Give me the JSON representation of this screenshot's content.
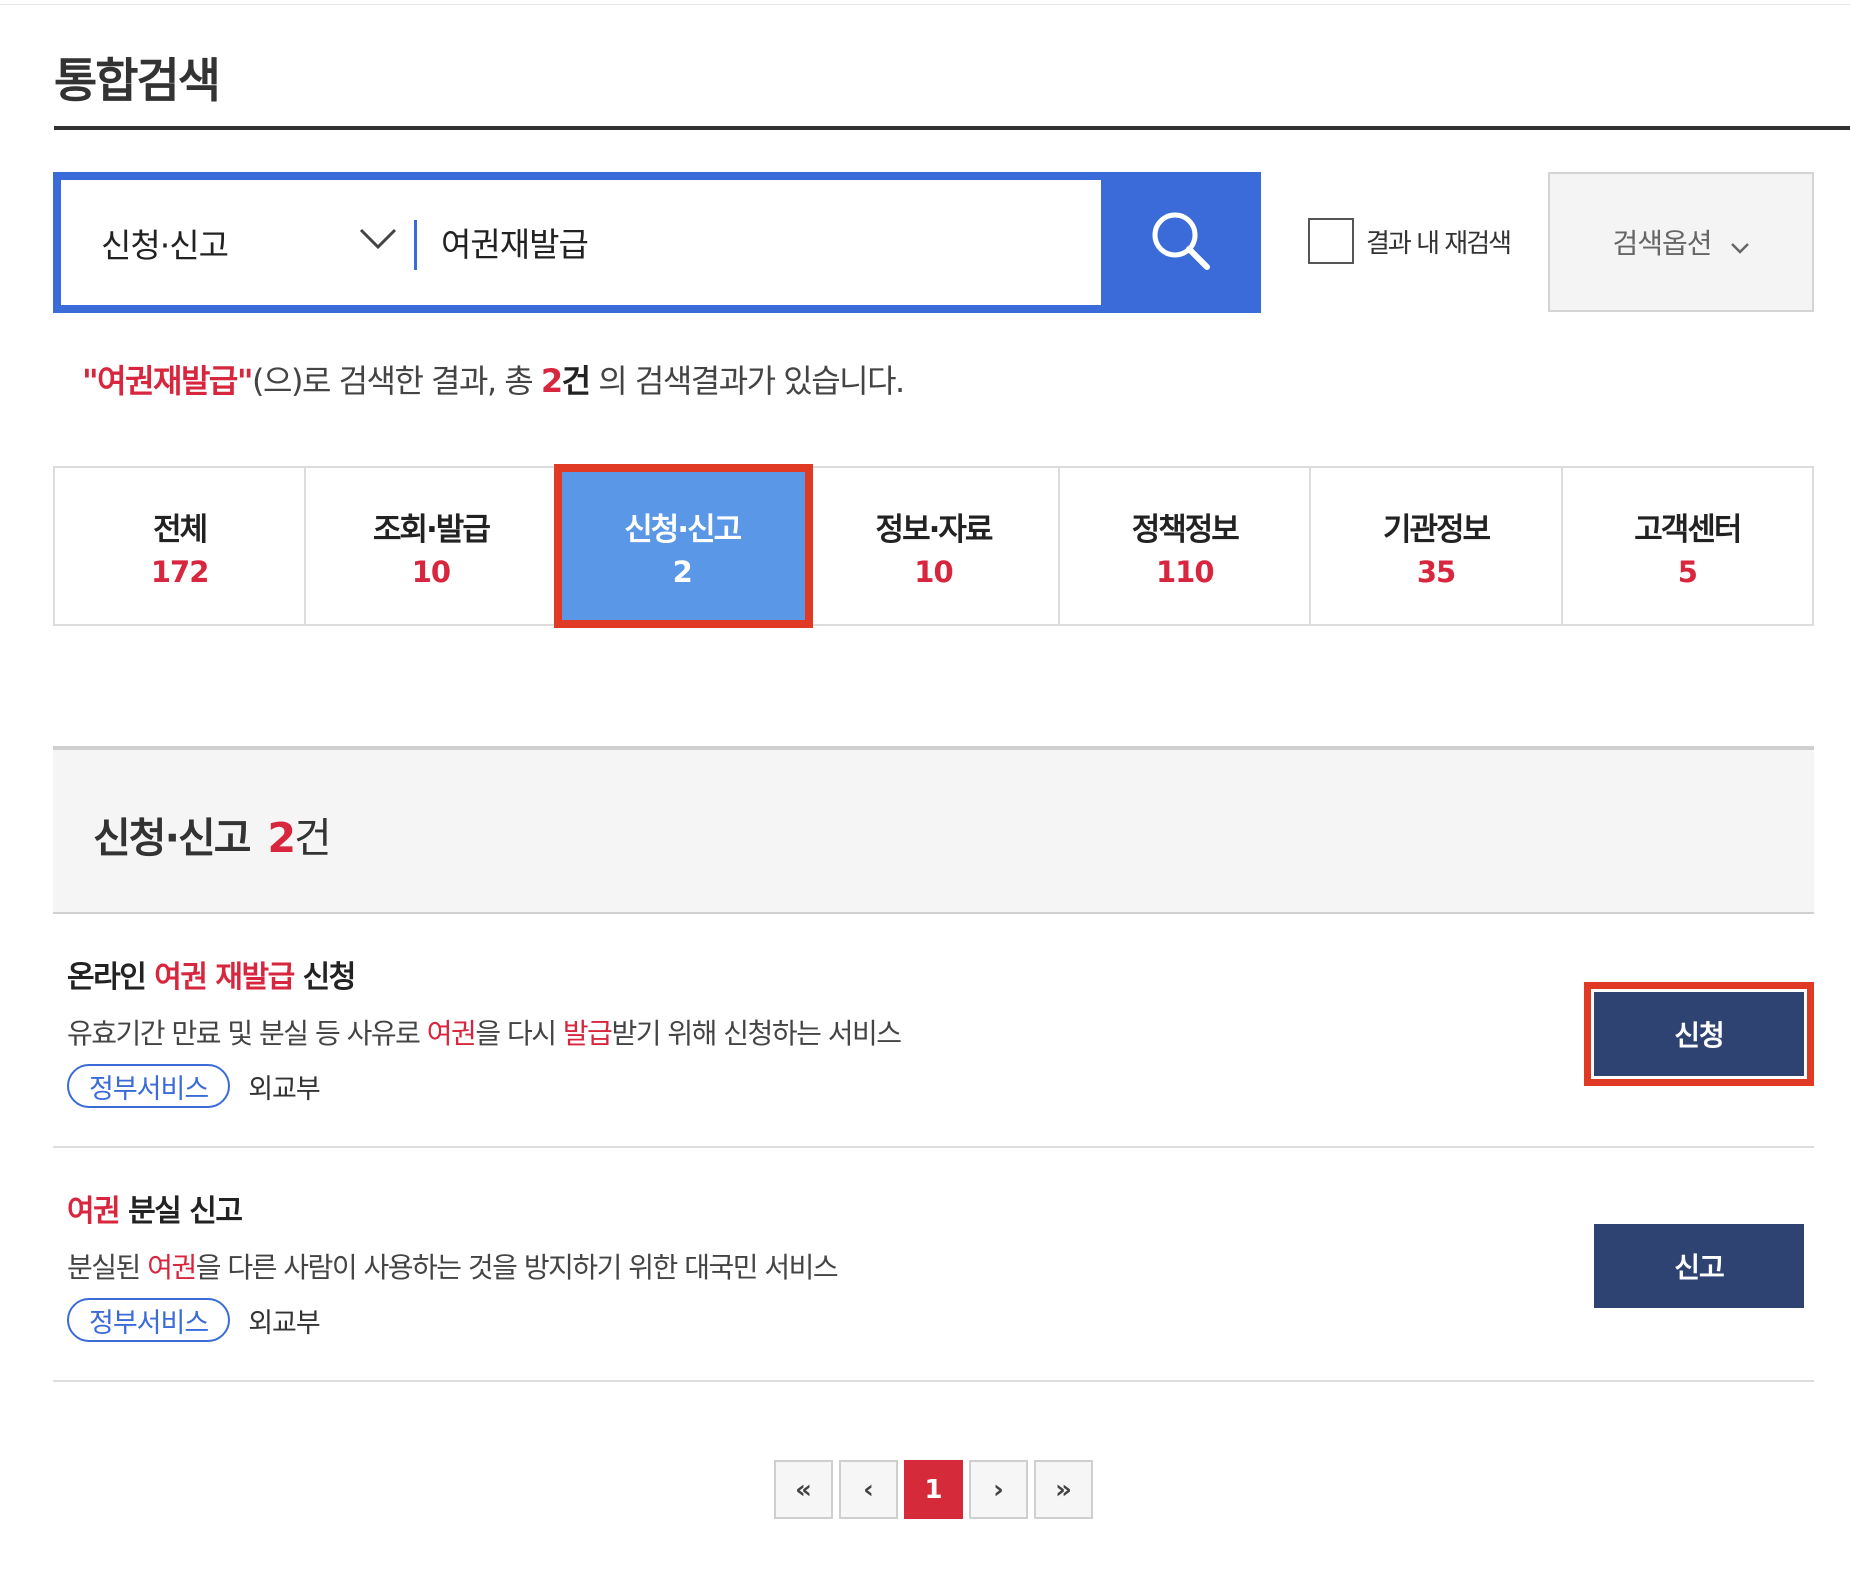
{
  "page": {
    "title": "통합검색"
  },
  "search": {
    "category": "신청·신고",
    "query": "여권재발급",
    "research_label": "결과 내 재검색",
    "options_label": "검색옵션"
  },
  "result_message": {
    "open_quote": "\"",
    "keyword": "여권재발급",
    "close_quote": "\"",
    "middle": "(으)로 검색한 결과, 총 ",
    "count": "2",
    "unit": "건",
    "tail": " 의 검색결과가 있습니다."
  },
  "tabs": [
    {
      "label": "전체",
      "count": "172"
    },
    {
      "label": "조회·발급",
      "count": "10"
    },
    {
      "label": "신청·신고",
      "count": "2"
    },
    {
      "label": "정보·자료",
      "count": "10"
    },
    {
      "label": "정책정보",
      "count": "110"
    },
    {
      "label": "기관정보",
      "count": "35"
    },
    {
      "label": "고객센터",
      "count": "5"
    }
  ],
  "section": {
    "title": "신청·신고",
    "count": "2",
    "unit": "건"
  },
  "results": [
    {
      "title_pre": "온라인 ",
      "title_hl1": "여권",
      "title_sp": " ",
      "title_hl2": "재발급",
      "title_post": " 신청",
      "desc_pre": "유효기간 만료 및 분실 등 사유로 ",
      "desc_hl1": "여권",
      "desc_mid": "을 다시 ",
      "desc_hl2": "발급",
      "desc_post": "받기 위해 신청하는 서비스",
      "badge": "정부서비스",
      "org": "외교부",
      "action": "신청"
    },
    {
      "title_hl1": "여권",
      "title_post": " 분실 신고",
      "desc_pre": "분실된 ",
      "desc_hl1": "여권",
      "desc_post": "을 다른 사람이 사용하는 것을 방지하기 위한 대국민 서비스",
      "badge": "정부서비스",
      "org": "외교부",
      "action": "신고"
    }
  ],
  "pagination": {
    "first": "«",
    "prev": "‹",
    "current": "1",
    "next": "›",
    "last": "»"
  },
  "colors": {
    "accent": "#3a6bd8",
    "highlight": "#d7263d",
    "active_tab": "#5a97e6",
    "button": "#2e4372"
  }
}
